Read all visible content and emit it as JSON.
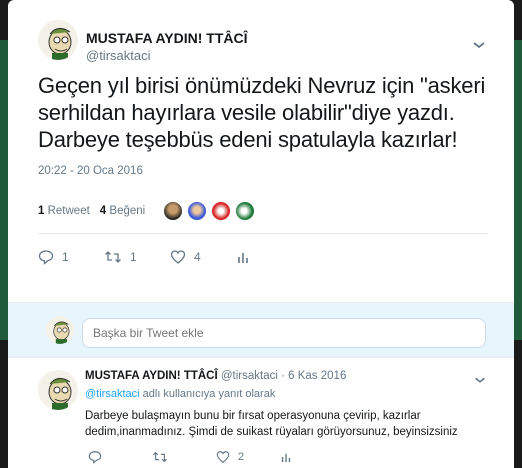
{
  "tweet": {
    "display_name": "MUSTAFA AYDIN! TTÂCÎ",
    "handle": "@tirsaktaci",
    "text": "Geçen yıl birisi önümüzdeki Nevruz için \"askeri serhildan hayırlara vesile olabilir\"diye yazdı. Darbeye teşebbüs edeni spatulayla kazırlar!",
    "timestamp": "20:22 - 20 Oca 2016",
    "retweets_count": "1",
    "retweets_label": "Retweet",
    "likes_count": "4",
    "likes_label": "Beğeni",
    "actions": {
      "reply_count": "1",
      "retweet_count": "1",
      "like_count": "4"
    }
  },
  "reply_box": {
    "placeholder": "Başka bir Tweet ekle"
  },
  "reply": {
    "display_name": "MUSTAFA AYDIN! TTÂCÎ",
    "handle": "@tirsaktaci",
    "date": "· 6 Kas 2016",
    "replying_to": "@tirsaktaci",
    "replying_suffix": " adlı kullanıcıya yanıt olarak",
    "text": "Darbeye bulaşmayın bunu bir fırsat operasyonuna çevirip, kazırlar dedim,inanmadınız. Şimdi de suikast rüyaları görüyorsunuz, beyinsizsiniz",
    "actions": {
      "reply_count": "",
      "retweet_count": "",
      "like_count": "2"
    }
  },
  "colors": {
    "accent": "#1da1f2",
    "muted": "#657786",
    "text": "#14171a",
    "reply_bg": "#e8f5fd",
    "background": "#1f5b3a"
  },
  "icons": [
    "chevron-down-icon",
    "reply-icon",
    "retweet-icon",
    "heart-icon",
    "analytics-icon"
  ]
}
